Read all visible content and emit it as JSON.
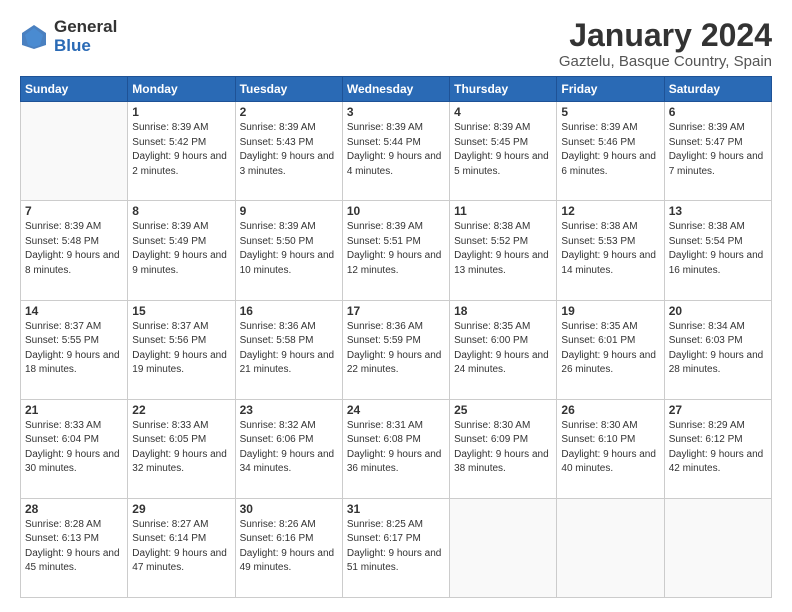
{
  "header": {
    "logo_general": "General",
    "logo_blue": "Blue",
    "month_title": "January 2024",
    "location": "Gaztelu, Basque Country, Spain"
  },
  "weekdays": [
    "Sunday",
    "Monday",
    "Tuesday",
    "Wednesday",
    "Thursday",
    "Friday",
    "Saturday"
  ],
  "weeks": [
    [
      {
        "day": "",
        "sunrise": "",
        "sunset": "",
        "daylight": "",
        "empty": true
      },
      {
        "day": "1",
        "sunrise": "Sunrise: 8:39 AM",
        "sunset": "Sunset: 5:42 PM",
        "daylight": "Daylight: 9 hours and 2 minutes.",
        "empty": false
      },
      {
        "day": "2",
        "sunrise": "Sunrise: 8:39 AM",
        "sunset": "Sunset: 5:43 PM",
        "daylight": "Daylight: 9 hours and 3 minutes.",
        "empty": false
      },
      {
        "day": "3",
        "sunrise": "Sunrise: 8:39 AM",
        "sunset": "Sunset: 5:44 PM",
        "daylight": "Daylight: 9 hours and 4 minutes.",
        "empty": false
      },
      {
        "day": "4",
        "sunrise": "Sunrise: 8:39 AM",
        "sunset": "Sunset: 5:45 PM",
        "daylight": "Daylight: 9 hours and 5 minutes.",
        "empty": false
      },
      {
        "day": "5",
        "sunrise": "Sunrise: 8:39 AM",
        "sunset": "Sunset: 5:46 PM",
        "daylight": "Daylight: 9 hours and 6 minutes.",
        "empty": false
      },
      {
        "day": "6",
        "sunrise": "Sunrise: 8:39 AM",
        "sunset": "Sunset: 5:47 PM",
        "daylight": "Daylight: 9 hours and 7 minutes.",
        "empty": false
      }
    ],
    [
      {
        "day": "7",
        "sunrise": "Sunrise: 8:39 AM",
        "sunset": "Sunset: 5:48 PM",
        "daylight": "Daylight: 9 hours and 8 minutes.",
        "empty": false
      },
      {
        "day": "8",
        "sunrise": "Sunrise: 8:39 AM",
        "sunset": "Sunset: 5:49 PM",
        "daylight": "Daylight: 9 hours and 9 minutes.",
        "empty": false
      },
      {
        "day": "9",
        "sunrise": "Sunrise: 8:39 AM",
        "sunset": "Sunset: 5:50 PM",
        "daylight": "Daylight: 9 hours and 10 minutes.",
        "empty": false
      },
      {
        "day": "10",
        "sunrise": "Sunrise: 8:39 AM",
        "sunset": "Sunset: 5:51 PM",
        "daylight": "Daylight: 9 hours and 12 minutes.",
        "empty": false
      },
      {
        "day": "11",
        "sunrise": "Sunrise: 8:38 AM",
        "sunset": "Sunset: 5:52 PM",
        "daylight": "Daylight: 9 hours and 13 minutes.",
        "empty": false
      },
      {
        "day": "12",
        "sunrise": "Sunrise: 8:38 AM",
        "sunset": "Sunset: 5:53 PM",
        "daylight": "Daylight: 9 hours and 14 minutes.",
        "empty": false
      },
      {
        "day": "13",
        "sunrise": "Sunrise: 8:38 AM",
        "sunset": "Sunset: 5:54 PM",
        "daylight": "Daylight: 9 hours and 16 minutes.",
        "empty": false
      }
    ],
    [
      {
        "day": "14",
        "sunrise": "Sunrise: 8:37 AM",
        "sunset": "Sunset: 5:55 PM",
        "daylight": "Daylight: 9 hours and 18 minutes.",
        "empty": false
      },
      {
        "day": "15",
        "sunrise": "Sunrise: 8:37 AM",
        "sunset": "Sunset: 5:56 PM",
        "daylight": "Daylight: 9 hours and 19 minutes.",
        "empty": false
      },
      {
        "day": "16",
        "sunrise": "Sunrise: 8:36 AM",
        "sunset": "Sunset: 5:58 PM",
        "daylight": "Daylight: 9 hours and 21 minutes.",
        "empty": false
      },
      {
        "day": "17",
        "sunrise": "Sunrise: 8:36 AM",
        "sunset": "Sunset: 5:59 PM",
        "daylight": "Daylight: 9 hours and 22 minutes.",
        "empty": false
      },
      {
        "day": "18",
        "sunrise": "Sunrise: 8:35 AM",
        "sunset": "Sunset: 6:00 PM",
        "daylight": "Daylight: 9 hours and 24 minutes.",
        "empty": false
      },
      {
        "day": "19",
        "sunrise": "Sunrise: 8:35 AM",
        "sunset": "Sunset: 6:01 PM",
        "daylight": "Daylight: 9 hours and 26 minutes.",
        "empty": false
      },
      {
        "day": "20",
        "sunrise": "Sunrise: 8:34 AM",
        "sunset": "Sunset: 6:03 PM",
        "daylight": "Daylight: 9 hours and 28 minutes.",
        "empty": false
      }
    ],
    [
      {
        "day": "21",
        "sunrise": "Sunrise: 8:33 AM",
        "sunset": "Sunset: 6:04 PM",
        "daylight": "Daylight: 9 hours and 30 minutes.",
        "empty": false
      },
      {
        "day": "22",
        "sunrise": "Sunrise: 8:33 AM",
        "sunset": "Sunset: 6:05 PM",
        "daylight": "Daylight: 9 hours and 32 minutes.",
        "empty": false
      },
      {
        "day": "23",
        "sunrise": "Sunrise: 8:32 AM",
        "sunset": "Sunset: 6:06 PM",
        "daylight": "Daylight: 9 hours and 34 minutes.",
        "empty": false
      },
      {
        "day": "24",
        "sunrise": "Sunrise: 8:31 AM",
        "sunset": "Sunset: 6:08 PM",
        "daylight": "Daylight: 9 hours and 36 minutes.",
        "empty": false
      },
      {
        "day": "25",
        "sunrise": "Sunrise: 8:30 AM",
        "sunset": "Sunset: 6:09 PM",
        "daylight": "Daylight: 9 hours and 38 minutes.",
        "empty": false
      },
      {
        "day": "26",
        "sunrise": "Sunrise: 8:30 AM",
        "sunset": "Sunset: 6:10 PM",
        "daylight": "Daylight: 9 hours and 40 minutes.",
        "empty": false
      },
      {
        "day": "27",
        "sunrise": "Sunrise: 8:29 AM",
        "sunset": "Sunset: 6:12 PM",
        "daylight": "Daylight: 9 hours and 42 minutes.",
        "empty": false
      }
    ],
    [
      {
        "day": "28",
        "sunrise": "Sunrise: 8:28 AM",
        "sunset": "Sunset: 6:13 PM",
        "daylight": "Daylight: 9 hours and 45 minutes.",
        "empty": false
      },
      {
        "day": "29",
        "sunrise": "Sunrise: 8:27 AM",
        "sunset": "Sunset: 6:14 PM",
        "daylight": "Daylight: 9 hours and 47 minutes.",
        "empty": false
      },
      {
        "day": "30",
        "sunrise": "Sunrise: 8:26 AM",
        "sunset": "Sunset: 6:16 PM",
        "daylight": "Daylight: 9 hours and 49 minutes.",
        "empty": false
      },
      {
        "day": "31",
        "sunrise": "Sunrise: 8:25 AM",
        "sunset": "Sunset: 6:17 PM",
        "daylight": "Daylight: 9 hours and 51 minutes.",
        "empty": false
      },
      {
        "day": "",
        "sunrise": "",
        "sunset": "",
        "daylight": "",
        "empty": true
      },
      {
        "day": "",
        "sunrise": "",
        "sunset": "",
        "daylight": "",
        "empty": true
      },
      {
        "day": "",
        "sunrise": "",
        "sunset": "",
        "daylight": "",
        "empty": true
      }
    ]
  ]
}
